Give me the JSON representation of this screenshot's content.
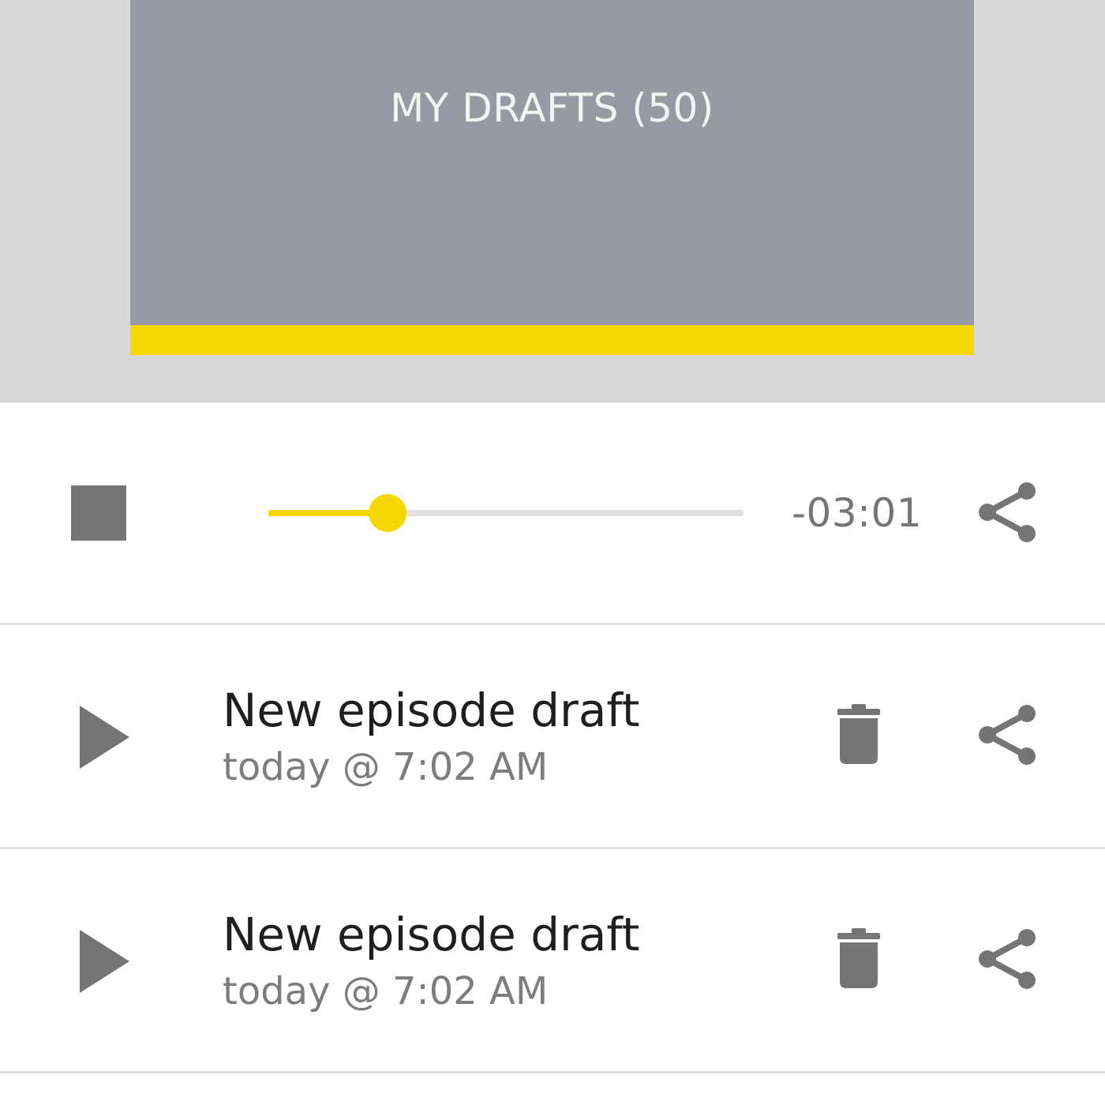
{
  "tabs": {
    "drafts_label": "MY DRAFTS (50)",
    "indicator_color": "#f4d800"
  },
  "player": {
    "stop_icon": "stop-icon",
    "progress": 0.25,
    "time_remaining": "-03:01",
    "share_icon": "share-icon"
  },
  "drafts": [
    {
      "title": "New episode draft",
      "timestamp": "today @ 7:02 AM",
      "play_icon": "play-icon",
      "delete_icon": "trash-icon",
      "share_icon": "share-icon"
    },
    {
      "title": "New episode draft",
      "timestamp": "today @ 7:02 AM",
      "play_icon": "play-icon",
      "delete_icon": "trash-icon",
      "share_icon": "share-icon"
    }
  ],
  "colors": {
    "accent": "#f4d800",
    "tab_background": "#979aa2",
    "icon": "#757575"
  }
}
